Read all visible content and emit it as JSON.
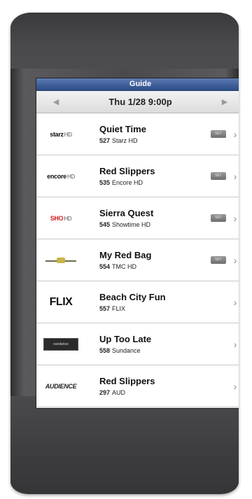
{
  "screen": {
    "title": "Guide",
    "date_label": "Thu 1/28 9:00p",
    "prev_icon": "left-triangle-icon",
    "next_icon": "right-triangle-icon"
  },
  "programs": [
    {
      "logo_text": "starz",
      "logo_suffix": "HD",
      "title": "Quiet Time",
      "channel_number": "527",
      "channel_name": "Starz HD",
      "has_badge": true,
      "badge_text": "SET"
    },
    {
      "logo_text": "encore",
      "logo_suffix": "HD",
      "title": "Red Slippers",
      "channel_number": "535",
      "channel_name": "Encore HD",
      "has_badge": true,
      "badge_text": "SET"
    },
    {
      "logo_text": "SHO",
      "logo_suffix": "HD",
      "title": "Sierra Quest",
      "channel_number": "545",
      "channel_name": "Showtime HD",
      "has_badge": true,
      "badge_text": "SET"
    },
    {
      "logo_text": "",
      "logo_suffix": "",
      "title": "My Red Bag",
      "channel_number": "554",
      "channel_name": "TMC HD",
      "has_badge": true,
      "badge_text": "SET"
    },
    {
      "logo_text": "FLIX",
      "logo_suffix": "",
      "title": "Beach City Fun",
      "channel_number": "557",
      "channel_name": "FLIX",
      "has_badge": false,
      "badge_text": ""
    },
    {
      "logo_text": "sundance",
      "logo_suffix": "",
      "title": "Up Too Late",
      "channel_number": "558",
      "channel_name": "Sundance",
      "has_badge": false,
      "badge_text": ""
    },
    {
      "logo_text": "AUDIENCE",
      "logo_suffix": "",
      "title": "Red Slippers",
      "channel_number": "297",
      "channel_name": "AUD",
      "has_badge": false,
      "badge_text": ""
    }
  ],
  "colors": {
    "titlebar": "#3f5f9b",
    "device_body": "#4a4a4d",
    "screen_bg": "#f4f4f4"
  }
}
